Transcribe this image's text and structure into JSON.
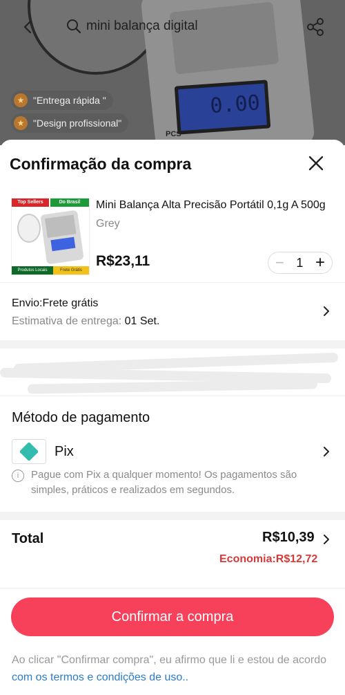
{
  "header": {
    "search_query": "mini balança digital",
    "icons": {
      "back": "chevron-left-icon",
      "search": "search-icon",
      "share": "share-icon"
    }
  },
  "product_tags": [
    "\"Entrega rápida \"",
    "\"Design profissional\""
  ],
  "scale_display": "0.00",
  "scale_mode_label": "PCS",
  "sheet": {
    "title": "Confirmação da compra",
    "product": {
      "name": "Mini Balança Alta Precisão Portátil 0,1g A 500g",
      "variant": "Grey",
      "price": "R$23,11",
      "quantity": "1",
      "minus": "−",
      "plus": "+",
      "image_badges": {
        "top_left": "Top Sellers",
        "top_right": "Do Brasil",
        "bottom_left": "Produtos Locais",
        "bottom_right": "Frete Grátis"
      }
    },
    "shipping": {
      "label": "Envio:Frete grátis",
      "estimate_prefix": "Estimativa de entrega:",
      "estimate_date": "01 Set."
    },
    "payment": {
      "title": "Método de pagamento",
      "method": "Pix",
      "info": "Pague com Pix a qualquer momento! Os pagamentos são simples, práticos e realizados em segundos.",
      "info_icon": "i"
    },
    "total": {
      "label": "Total",
      "value": "R$10,39",
      "saving": "Economia:R$12,72"
    },
    "confirm_button": "Confirmar a compra",
    "terms": {
      "text": "Ao clicar \"Confirmar compra\", eu afirmo que li e estou de acordo",
      "link": "com os termos e condições de uso.."
    }
  },
  "colors": {
    "accent": "#f7415a",
    "saving": "#d53a3a",
    "link": "#2b7bc7",
    "pix": "#32bcad"
  }
}
